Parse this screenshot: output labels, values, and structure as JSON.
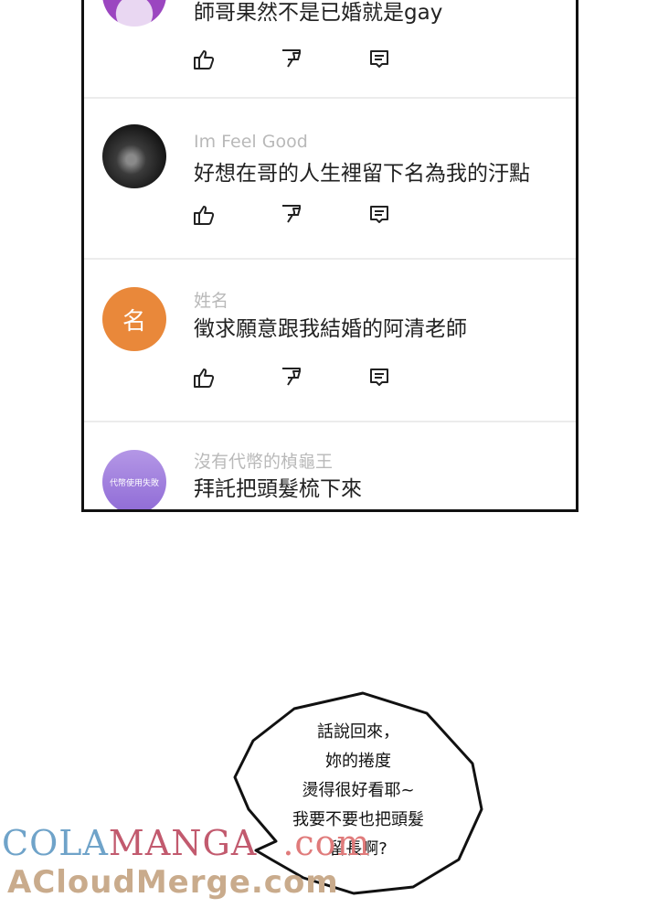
{
  "comments": [
    {
      "username": "",
      "text": "師哥果然不是已婚就是gay",
      "avatar_icon": "purple-avatar-icon"
    },
    {
      "username": "Im Feel Good",
      "text": "好想在哥的人生裡留下名為我的汙點",
      "avatar_icon": "night-sky-avatar-icon"
    },
    {
      "username": "姓名",
      "text": "徵求願意跟我結婚的阿清老師",
      "avatar_letter": "名"
    },
    {
      "username": "沒有代幣的楨龜王",
      "text": "拜託把頭髮梳下來",
      "avatar_label": "代幣使用失敗"
    }
  ],
  "bubble": {
    "lines": [
      "話說回來，",
      "妳的捲度",
      "燙得很好看耶~",
      "我要不要也把頭髮",
      "留長啊?"
    ]
  },
  "watermark": {
    "cola": "COLA",
    "manga": "MANGA",
    "com": ".com",
    "acloud": "ACloudMerge.com"
  }
}
